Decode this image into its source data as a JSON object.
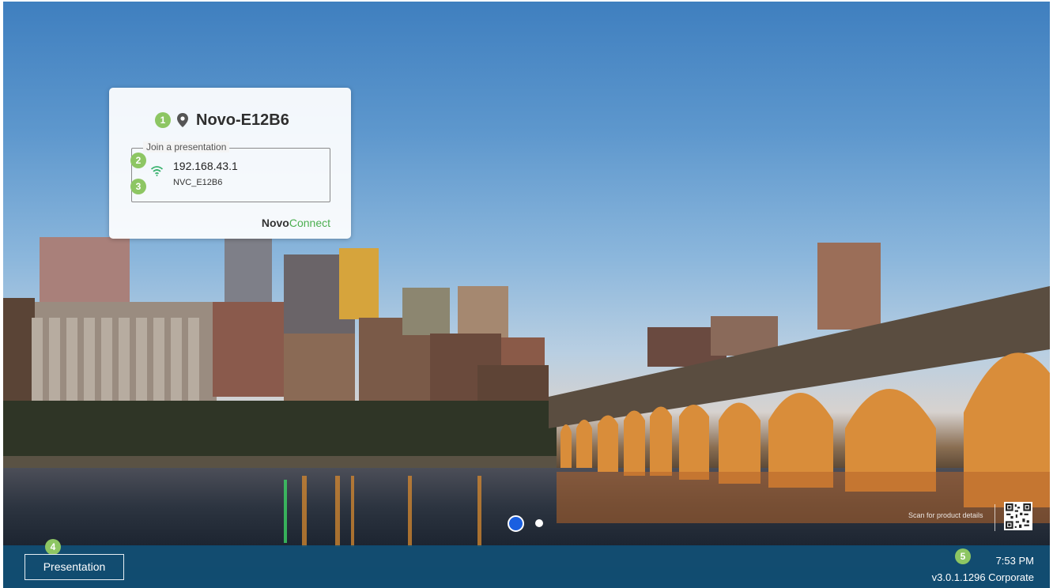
{
  "card": {
    "device_name": "Novo-E12B6",
    "join_label": "Join a presentation",
    "ip_address": "192.168.43.1",
    "ssid": "NVC_E12B6",
    "brand_part1": "Novo",
    "brand_part2": "Connect"
  },
  "badges": {
    "b1": "1",
    "b2": "2",
    "b3": "3",
    "b4": "4",
    "b5": "5"
  },
  "pager": {
    "pages": 2,
    "active_page": 1
  },
  "qr": {
    "caption": "Scan for product details"
  },
  "bottom_bar": {
    "presentation_button": "Presentation",
    "time": "7:53 PM",
    "version": "v3.0.1.1296 Corporate"
  },
  "colors": {
    "badge": "#8dc663",
    "bar": "#105078",
    "accent_dot": "#1a5fe0",
    "brand_green": "#4caf50"
  },
  "icons": {
    "location": "pin-icon",
    "network": "wifi-icon"
  }
}
